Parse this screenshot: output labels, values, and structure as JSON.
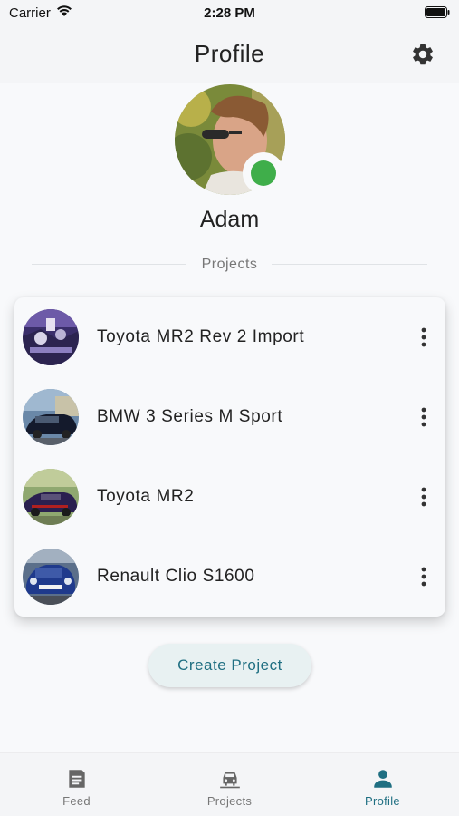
{
  "status_bar": {
    "carrier": "Carrier",
    "time": "2:28 PM"
  },
  "header": {
    "title": "Profile",
    "settings_icon": "gear-icon"
  },
  "profile": {
    "name": "Adam",
    "online": true,
    "online_color": "#3fae4a"
  },
  "section_label": "Projects",
  "projects": [
    {
      "name": "Toyota MR2 Rev 2 Import"
    },
    {
      "name": "BMW 3 Series M Sport"
    },
    {
      "name": "Toyota MR2"
    },
    {
      "name": "Renault Clio S1600"
    }
  ],
  "create_button": {
    "label": "Create Project"
  },
  "bottom_nav": {
    "items": [
      {
        "label": "Feed",
        "icon": "feed-icon",
        "active": false
      },
      {
        "label": "Projects",
        "icon": "car-icon",
        "active": false
      },
      {
        "label": "Profile",
        "icon": "person-icon",
        "active": true
      }
    ],
    "active_color": "#1f6f82"
  }
}
